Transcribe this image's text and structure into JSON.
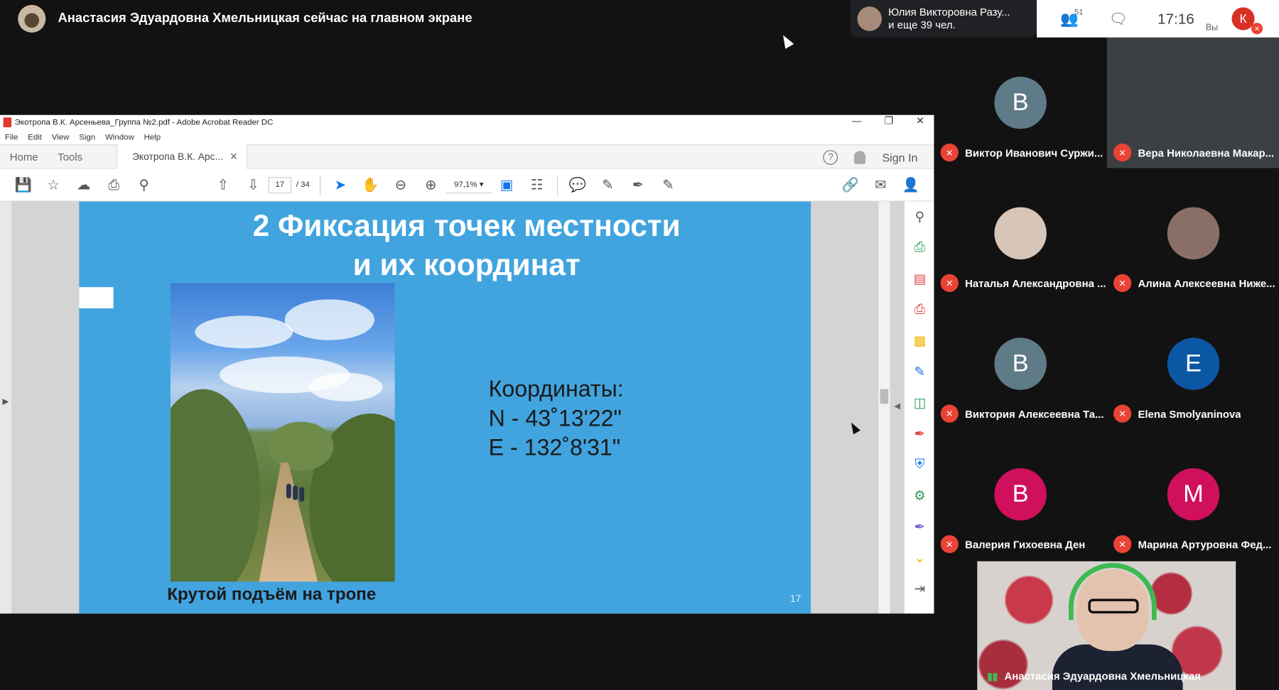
{
  "meet": {
    "presenting_text": "Анастасия Эдуардовна Хмельницкая сейчас на главном экране",
    "chip_line1": "Юлия Викторовна Разу...",
    "chip_line2": "и еще 39 чел.",
    "people_count": "51",
    "clock": "17:16",
    "self_label": "Вы",
    "self_initial": "К"
  },
  "acrobat": {
    "window_title": "Экотропа В.К. Арсеньева_Группа №2.pdf - Adobe Acrobat Reader DC",
    "menu": [
      "File",
      "Edit",
      "View",
      "Sign",
      "Window",
      "Help"
    ],
    "tab_home": "Home",
    "tab_tools": "Tools",
    "tab_doc": "Экотропа В.К. Арс...",
    "sign_in": "Sign In",
    "page_current": "17",
    "page_total": "/ 34",
    "zoom": "97,1%"
  },
  "slide": {
    "title_line1": "2 Фиксация точек местности",
    "title_line2": "и их координат",
    "caption": "Крутой подъём на тропе",
    "coords_label": "Координаты:",
    "coords_n": "N - 43˚13'22\"",
    "coords_e": "E - 132˚8'31\"",
    "page_number": "17"
  },
  "participants": [
    {
      "name": "Виктор Иванович Суржи...",
      "initial": "В",
      "color": "#5f7b87"
    },
    {
      "name": "Вера Николаевна Макар...",
      "initial": "",
      "color": "#3c4043"
    },
    {
      "name": "Наталья Александровна ...",
      "initial": "",
      "color": "#d7c6b8"
    },
    {
      "name": "Алина Алексеевна Ниже...",
      "initial": "",
      "color": "#8a6f66"
    },
    {
      "name": "Виктория Алексеевна Та...",
      "initial": "В",
      "color": "#5f7b87"
    },
    {
      "name": "Elena Smolyaninova",
      "initial": "E",
      "color": "#0b57a4"
    },
    {
      "name": "Валерия Гихоевна Ден",
      "initial": "В",
      "color": "#d0105c"
    },
    {
      "name": "Марина Артуровна Фед...",
      "initial": "М",
      "color": "#d0105c"
    }
  ],
  "speaker": {
    "name": "Анастасия Эдуардовна Хмельницкая"
  }
}
